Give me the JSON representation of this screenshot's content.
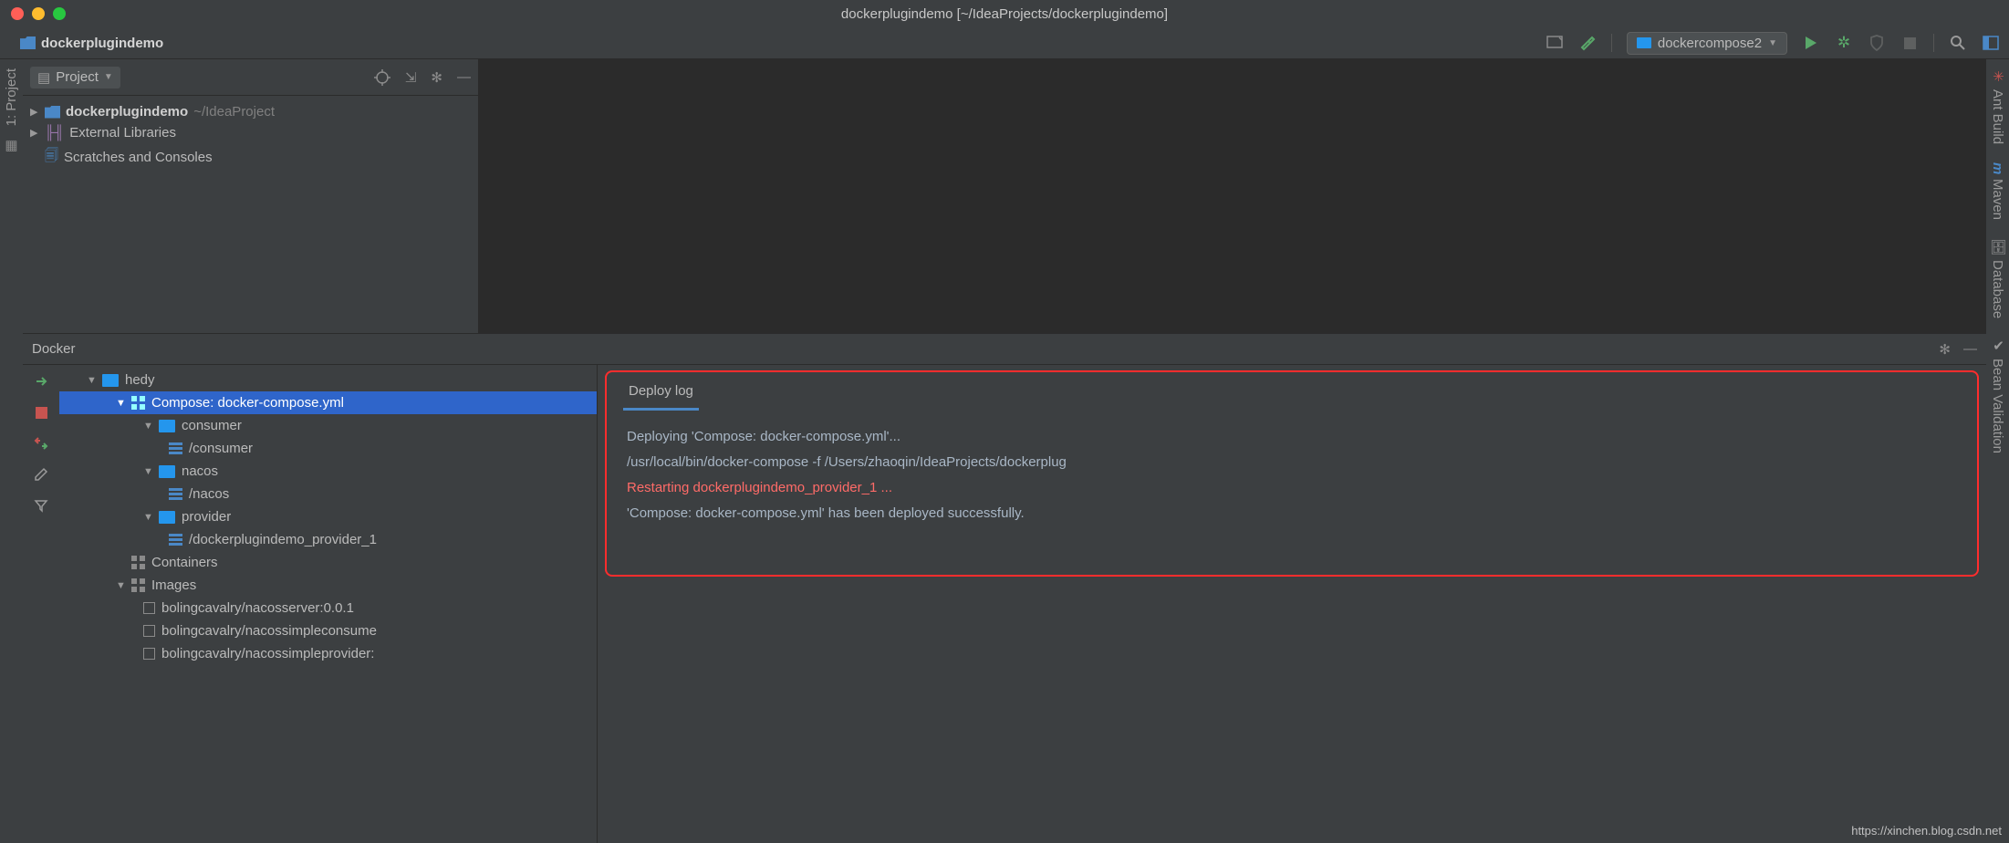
{
  "window": {
    "title": "dockerplugindemo [~/IdeaProjects/dockerplugindemo]"
  },
  "breadcrumb": {
    "project": "dockerplugindemo"
  },
  "toolbar": {
    "run_config": "dockercompose2"
  },
  "left_stripe": {
    "project": "1: Project"
  },
  "right_stripe": {
    "ant": "Ant Build",
    "maven": "Maven",
    "database": "Database",
    "bean": "Bean Validation"
  },
  "project_panel": {
    "header": "Project",
    "root": "dockerplugindemo",
    "root_path": "~/IdeaProject",
    "libs": "External Libraries",
    "scratches": "Scratches and Consoles"
  },
  "docker_panel": {
    "title": "Docker",
    "tree": {
      "host": "hedy",
      "compose": "Compose: docker-compose.yml",
      "svc1": "consumer",
      "svc1_c": "/consumer",
      "svc2": "nacos",
      "svc2_c": "/nacos",
      "svc3": "provider",
      "svc3_c": "/dockerplugindemo_provider_1",
      "containers": "Containers",
      "images": "Images",
      "img1": "bolingcavalry/nacosserver:0.0.1",
      "img2": "bolingcavalry/nacossimpleconsume",
      "img3": "bolingcavalry/nacossimpleprovider:"
    },
    "tab": "Deploy log",
    "log": {
      "l1": "Deploying 'Compose: docker-compose.yml'...",
      "l2": "/usr/local/bin/docker-compose -f /Users/zhaoqin/IdeaProjects/dockerplug",
      "l3": "Restarting dockerplugindemo_provider_1 ...",
      "l4": "'Compose: docker-compose.yml' has been deployed successfully."
    }
  },
  "watermark": "https://xinchen.blog.csdn.net"
}
